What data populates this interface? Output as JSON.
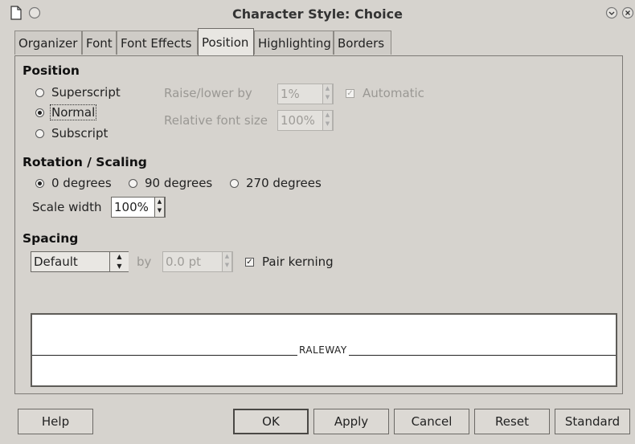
{
  "window": {
    "title": "Character Style: Choice"
  },
  "tabs": [
    {
      "label": "Organizer"
    },
    {
      "label": "Font"
    },
    {
      "label": "Font Effects"
    },
    {
      "label": "Position"
    },
    {
      "label": "Highlighting"
    },
    {
      "label": "Borders"
    }
  ],
  "position": {
    "heading": "Position",
    "superscript_label": "Superscript",
    "normal_label": "Normal",
    "subscript_label": "Subscript",
    "selected": "Normal",
    "raise_label": "Raise/lower by",
    "raise_value": "1%",
    "automatic_label": "Automatic",
    "automatic_checked": true,
    "relative_label": "Relative font size",
    "relative_value": "100%"
  },
  "rotation": {
    "heading": "Rotation / Scaling",
    "deg0_label": "0 degrees",
    "deg90_label": "90 degrees",
    "deg270_label": "270 degrees",
    "selected": "0 degrees",
    "scale_label": "Scale width",
    "scale_value": "100%"
  },
  "spacing": {
    "heading": "Spacing",
    "mode_value": "Default",
    "by_label": "by",
    "by_value": "0.0 pt",
    "pair_kerning_label": "Pair kerning",
    "pair_kerning_checked": true
  },
  "preview": {
    "text": "RALEWAY"
  },
  "buttons": {
    "help": "Help",
    "ok": "OK",
    "apply": "Apply",
    "cancel": "Cancel",
    "reset": "Reset",
    "standard": "Standard"
  }
}
